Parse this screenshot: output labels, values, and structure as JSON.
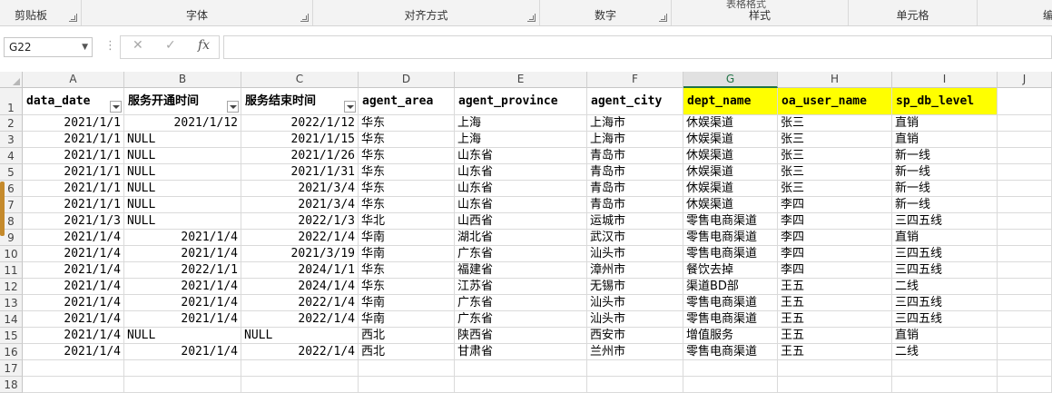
{
  "ribbon": {
    "groups": [
      {
        "label": "剪贴板"
      },
      {
        "label": "字体"
      },
      {
        "label": "对齐方式"
      },
      {
        "label": "数字"
      },
      {
        "label": "样式"
      },
      {
        "label": "单元格"
      },
      {
        "label": "编"
      }
    ],
    "cut_label": "表格格式"
  },
  "formula_bar": {
    "name_box": "G22",
    "cancel_icon": "✕",
    "enter_icon": "✓",
    "fx_label": "fx",
    "formula": ""
  },
  "columns": [
    "A",
    "B",
    "C",
    "D",
    "E",
    "F",
    "G",
    "H",
    "I",
    "J"
  ],
  "selected_column": "G",
  "row_numbers": [
    "1",
    "2",
    "3",
    "4",
    "5",
    "6",
    "7",
    "8",
    "9",
    "10",
    "11",
    "12",
    "13",
    "14",
    "15",
    "16",
    "17",
    "18"
  ],
  "header_row": [
    "data_date",
    "服务开通时间",
    "服务结束时间",
    "agent_area",
    "agent_province",
    "agent_city",
    "dept_name",
    "oa_user_name",
    "sp_db_level"
  ],
  "highlight_color": "#ffff00",
  "rows": [
    [
      "2021/1/1",
      "2021/1/12",
      "2022/1/12",
      "华东",
      "上海",
      "上海市",
      "休娱渠道",
      "张三",
      "直销"
    ],
    [
      "2021/1/1",
      "NULL",
      "2021/1/15",
      "华东",
      "上海",
      "上海市",
      "休娱渠道",
      "张三",
      "直销"
    ],
    [
      "2021/1/1",
      "NULL",
      "2021/1/26",
      "华东",
      "山东省",
      "青岛市",
      "休娱渠道",
      "张三",
      "新一线"
    ],
    [
      "2021/1/1",
      "NULL",
      "2021/1/31",
      "华东",
      "山东省",
      "青岛市",
      "休娱渠道",
      "张三",
      "新一线"
    ],
    [
      "2021/1/1",
      "NULL",
      "2021/3/4",
      "华东",
      "山东省",
      "青岛市",
      "休娱渠道",
      "张三",
      "新一线"
    ],
    [
      "2021/1/1",
      "NULL",
      "2021/3/4",
      "华东",
      "山东省",
      "青岛市",
      "休娱渠道",
      "李四",
      "新一线"
    ],
    [
      "2021/1/3",
      "NULL",
      "2022/1/3",
      "华北",
      "山西省",
      "运城市",
      "零售电商渠道",
      "李四",
      "三四五线"
    ],
    [
      "2021/1/4",
      "2021/1/4",
      "2022/1/4",
      "华南",
      "湖北省",
      "武汉市",
      "零售电商渠道",
      "李四",
      "直销"
    ],
    [
      "2021/1/4",
      "2021/1/4",
      "2021/3/19",
      "华南",
      "广东省",
      "汕头市",
      "零售电商渠道",
      "李四",
      "三四五线"
    ],
    [
      "2021/1/4",
      "2022/1/1",
      "2024/1/1",
      "华东",
      "福建省",
      "漳州市",
      "餐饮去掉",
      "李四",
      "三四五线"
    ],
    [
      "2021/1/4",
      "2021/1/4",
      "2024/1/4",
      "华东",
      "江苏省",
      "无锡市",
      "渠道BD部",
      "王五",
      "二线"
    ],
    [
      "2021/1/4",
      "2021/1/4",
      "2022/1/4",
      "华南",
      "广东省",
      "汕头市",
      "零售电商渠道",
      "王五",
      "三四五线"
    ],
    [
      "2021/1/4",
      "2021/1/4",
      "2022/1/4",
      "华南",
      "广东省",
      "汕头市",
      "零售电商渠道",
      "王五",
      "三四五线"
    ],
    [
      "2021/1/4",
      "NULL",
      "NULL",
      "西北",
      "陕西省",
      "西安市",
      "增值服务",
      "王五",
      "直销"
    ],
    [
      "2021/1/4",
      "2021/1/4",
      "2022/1/4",
      "西北",
      "甘肃省",
      "兰州市",
      "零售电商渠道",
      "王五",
      "二线"
    ]
  ]
}
